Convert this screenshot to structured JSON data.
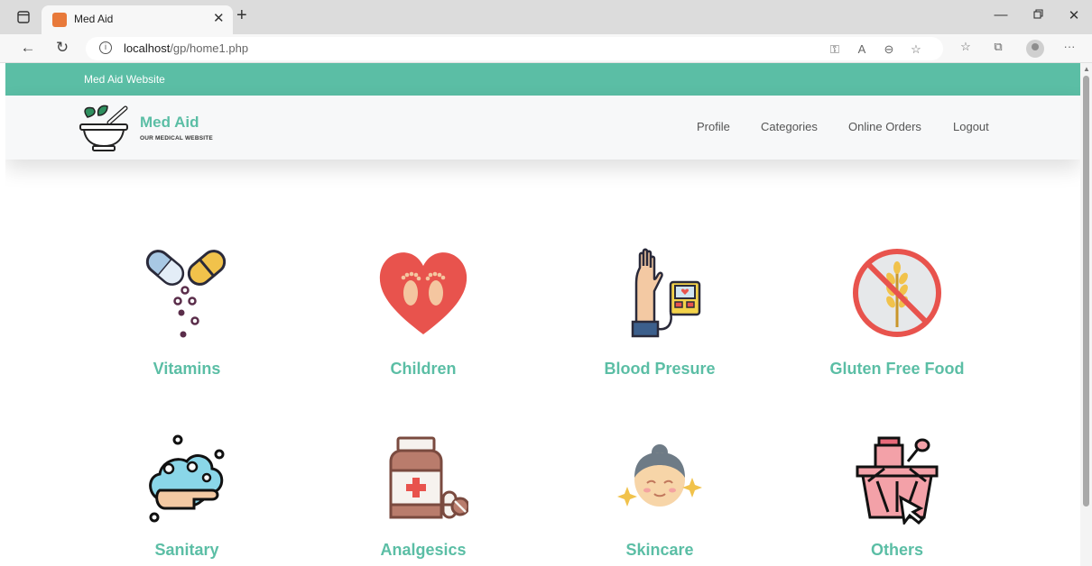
{
  "browser": {
    "tab_title": "Med Aid",
    "url_host": "localhost",
    "url_path": "/gp/home1.php"
  },
  "site": {
    "top_strip": "Med Aid Website",
    "brand_name": "Med Aid",
    "brand_tagline": "OUR MEDICAL WEBSITE",
    "nav": [
      "Profile",
      "Categories",
      "Online Orders",
      "Logout"
    ]
  },
  "categories": [
    {
      "label": "Vitamins",
      "icon": "pills-icon"
    },
    {
      "label": "Children",
      "icon": "baby-feet-heart-icon"
    },
    {
      "label": "Blood Presure",
      "icon": "blood-pressure-monitor-icon"
    },
    {
      "label": "Gluten Free Food",
      "icon": "no-wheat-icon"
    },
    {
      "label": "Sanitary",
      "icon": "hand-washing-icon"
    },
    {
      "label": "Analgesics",
      "icon": "medicine-bottle-icon"
    },
    {
      "label": "Skincare",
      "icon": "skincare-face-icon"
    },
    {
      "label": "Others",
      "icon": "shopping-basket-icon"
    }
  ],
  "colors": {
    "accent": "#5bbea5",
    "header_bg": "#f7f8f9"
  }
}
